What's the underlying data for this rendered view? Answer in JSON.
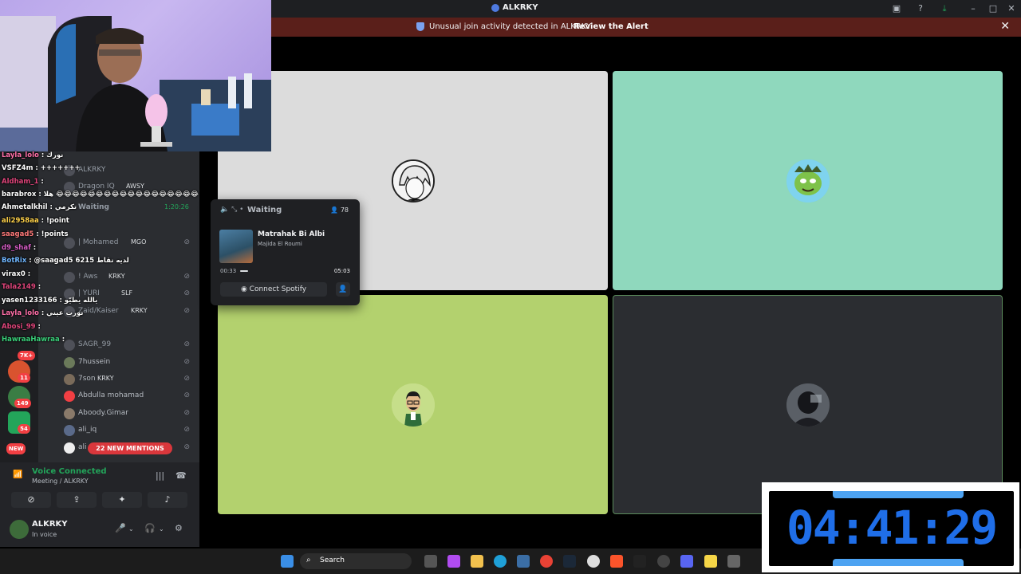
{
  "window": {
    "title": "ALKRKY"
  },
  "alert": {
    "message": "Unusual join activity detected in ALKRKY",
    "action": "Review the Alert"
  },
  "chat": [
    {
      "user": "Layla_lolo",
      "msg": ": نورك",
      "color": "#ff6fa8"
    },
    {
      "user": "VSFZ4m",
      "msg": ": +++++++",
      "color": "#ffffff"
    },
    {
      "user": "Aldham_1",
      "msg": ":",
      "color": "#e0457b"
    },
    {
      "user": "barabrox",
      "msg": ": هلا 😂😂😂😂😂😂😂😂😂😂😂😂😂😂😂😂😂😂",
      "color": "#ffffff"
    },
    {
      "user": "Ahmetalkhil",
      "msg": ": تكرمي",
      "color": "#ffffff"
    },
    {
      "user": "ali2958aa",
      "msg": ": !point",
      "color": "#ffd24a"
    },
    {
      "user": "saagad5",
      "msg": ": !points",
      "color": "#ff7a7a"
    },
    {
      "user": "d9_shaf",
      "msg": ":",
      "color": "#d65cc5"
    },
    {
      "user": "BotRix",
      "msg": ": @saagad5 6215 لديه نقاط",
      "color": "#6fb6ff"
    },
    {
      "user": "virax0",
      "msg": ":",
      "color": "#ffffff"
    },
    {
      "user": "Tala2149",
      "msg": ":",
      "color": "#e0457b"
    },
    {
      "user": "yasen1233166",
      "msg": ": يالله يطيّو",
      "color": "#ffffff"
    },
    {
      "user": "Layla_lolo",
      "msg": ": نورت عيني",
      "color": "#ff6fa8"
    },
    {
      "user": "Abosi_99",
      "msg": ":",
      "color": "#e0457b"
    },
    {
      "user": "HawraaHawraa",
      "msg": ":",
      "color": "#3ad07a"
    }
  ],
  "voice_channel": {
    "header": "Waiting",
    "timer": "1:20:26",
    "members": [
      {
        "name": "ALKRKY",
        "tag": ""
      },
      {
        "name": "Dragon IQ",
        "tag": "AWSY"
      },
      {
        "name": "| Mohamed",
        "tag": "MGO"
      },
      {
        "name": "! Aws",
        "tag": "KRKY"
      },
      {
        "name": "| YURI",
        "tag": "SLF"
      },
      {
        "name": "Zaid/Kaiser",
        "tag": "KRKY"
      },
      {
        "name": "SAGR_99",
        "tag": ""
      },
      {
        "name": "7hussein",
        "tag": ""
      },
      {
        "name": "7son",
        "tag": "KRKY"
      },
      {
        "name": "Abdulla mohamad",
        "tag": ""
      },
      {
        "name": "Aboody.Gimar",
        "tag": ""
      },
      {
        "name": "ali_iq",
        "tag": ""
      },
      {
        "name": "ali",
        "tag": ""
      }
    ],
    "mentions": "22 NEW MENTIONS"
  },
  "guild_badges": [
    "7K+",
    "11",
    "149",
    "54",
    "NEW"
  ],
  "voice_panel": {
    "status": "Voice Connected",
    "location": "Meeting / ALKRKY"
  },
  "user_panel": {
    "name": "ALKRKY",
    "status": "In voice"
  },
  "spotify": {
    "channel": "Waiting",
    "listeners": "78",
    "song": "Matrahak Bi Albi",
    "artist": "Majida El Roumi",
    "elapsed": "00:33",
    "duration": "05:03",
    "progress": 0.11,
    "connect_label": "Connect Spotify"
  },
  "taskbar": {
    "search_label": "Search"
  },
  "stream_timer": "04:41:29",
  "colors": {
    "accent": "#5865f2",
    "voice_green": "#23a55a",
    "alert_bg": "#5a1f1a",
    "timer_blue": "#1f6ee8"
  }
}
